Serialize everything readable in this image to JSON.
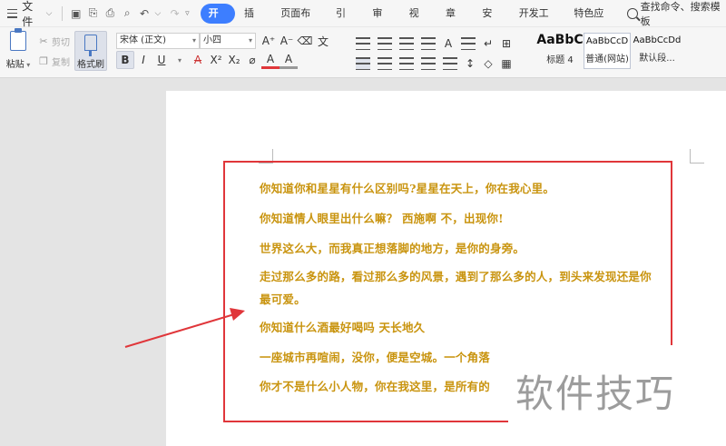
{
  "menubar": {
    "file_label": "文件",
    "tabs": [
      "开始",
      "插入",
      "页面布局",
      "引用",
      "审阅",
      "视图",
      "章节",
      "安全",
      "开发工具",
      "特色应用"
    ],
    "active_tab": "开始",
    "search_label": "查找命令、搜索模板"
  },
  "ribbon": {
    "paste_label": "粘贴",
    "cut_label": "剪切",
    "copy_label": "复制",
    "format_painter_label": "格式刷",
    "font_name": "宋体 (正文)",
    "font_size": "小四",
    "bold": "B",
    "italic": "I",
    "underline": "U",
    "font_color_letter": "A",
    "superscript": "X²",
    "subscript": "X₂",
    "grow_font": "A⁺",
    "shrink_font": "A⁻",
    "styles": [
      {
        "sample": "AaBbC",
        "name": "标题 4"
      },
      {
        "sample": "AaBbCcD",
        "name": "普通(网站)"
      },
      {
        "sample": "AaBbCcDd",
        "name": "默认段..."
      }
    ]
  },
  "document": {
    "lines": [
      "你知道你和星星有什么区别吗?星星在天上，你在我心里。",
      "你知道情人眼里出什么嘛？  西施啊  不，出现你!",
      "世界这么大，而我真正想落脚的地方，是你的身旁。",
      "走过那么多的路，看过那么多的风景，遇到了那么多的人，到头来发现还是你",
      "最可爱。",
      "你知道什么酒最好喝吗  天长地久",
      "一座城市再喧闹，没你，便是空城。一个角落",
      "你才不是什么小人物，你在我这里，是所有的"
    ],
    "text_color": "#c9940f",
    "highlight_color": "#e0363a"
  },
  "watermark": {
    "text": "软件技巧"
  }
}
